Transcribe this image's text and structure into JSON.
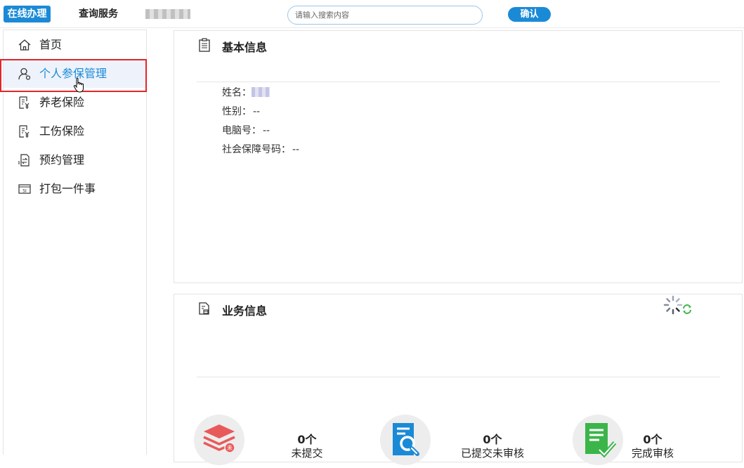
{
  "topbar": {
    "active_tab": "在线办理",
    "tab_query": "查询服务",
    "search_placeholder": "请输入搜索内容",
    "confirm_label": "确认"
  },
  "sidebar": {
    "items": [
      {
        "label": "首页",
        "icon": "home-icon"
      },
      {
        "label": "个人参保管理",
        "icon": "user-icon",
        "active": true
      },
      {
        "label": "养老保险",
        "icon": "document-yen-icon"
      },
      {
        "label": "工伤保险",
        "icon": "document-yen-icon"
      },
      {
        "label": "预约管理",
        "icon": "exchange-document-icon"
      },
      {
        "label": "打包一件事",
        "icon": "si-package-icon"
      }
    ]
  },
  "basic_info": {
    "title": "基本信息",
    "name_label": "姓名：",
    "gender_label": "性别：",
    "gender_value": "--",
    "computer_no_label": "电脑号：",
    "computer_no_value": "--",
    "ssn_label": "社会保障号码：",
    "ssn_value": "--"
  },
  "business_info": {
    "title": "业务信息",
    "stats": [
      {
        "count": "0个",
        "label": "未提交"
      },
      {
        "count": "0个",
        "label": "已提交未审核"
      },
      {
        "count": "0个",
        "label": "完成审核"
      }
    ]
  },
  "colors": {
    "accent": "#1b8ad6",
    "highlight_border": "#e2262a",
    "stack_red": "#e85a5a",
    "doc_blue": "#1b8ad6",
    "check_green": "#3bb54a"
  }
}
